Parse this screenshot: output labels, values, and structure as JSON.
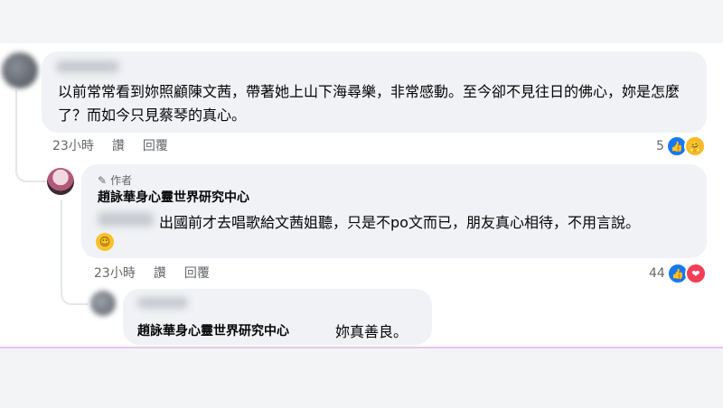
{
  "comment1": {
    "text": "以前常常看到妳照顧陳文茜，帶著她上山下海尋樂，非常感動。至今卻不見往日的佛心，妳是怎麼了？而如今只見蔡琴的真心。",
    "time": "23小時",
    "like_action": "讚",
    "reply_action": "回覆",
    "reaction_count": "5",
    "reaction_icons": [
      "like-icon",
      "care-icon"
    ]
  },
  "reply1": {
    "author_badge": "作者",
    "author_badge_icon": "pen-icon",
    "page_name": "趙詠華身心靈世界研究中心",
    "text": "出國前才去唱歌給文茜姐聽，只是不po文而已，朋友真心相待，不用言說。",
    "emoji_icon": "smile-emoji",
    "time": "23小時",
    "like_action": "讚",
    "reply_action": "回覆",
    "reaction_count": "44",
    "reaction_icons": [
      "like-icon",
      "love-icon"
    ]
  },
  "reply2": {
    "mention": "趙詠華身心靈世界研究中心",
    "text": "妳真善良。"
  },
  "colors": {
    "bubble": "#f0f2f5",
    "meta_text": "#65676b",
    "like_blue": "#1877f2",
    "love_red": "#f33e58",
    "care_yellow": "#f7b928"
  }
}
